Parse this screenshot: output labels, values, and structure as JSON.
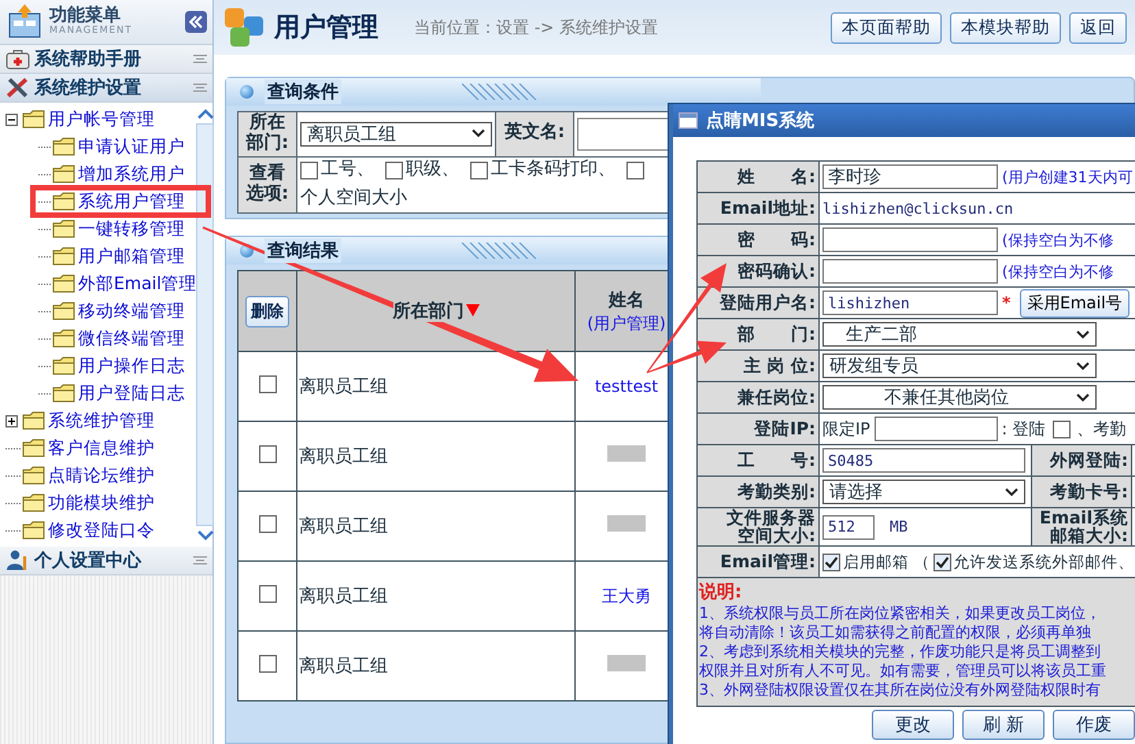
{
  "sidebar": {
    "title": "功能菜单",
    "subtitle": "MANAGEMENT",
    "sections": [
      {
        "label": "系统帮助手册",
        "kind": "help",
        "expanded": false
      },
      {
        "label": "系统维护设置",
        "kind": "tools",
        "expanded": true,
        "tree": [
          {
            "label": "用户帐号管理",
            "expanded": true,
            "highlighted": false,
            "children": [
              {
                "label": "申请认证用户",
                "highlighted": false
              },
              {
                "label": "增加系统用户",
                "highlighted": false
              },
              {
                "label": "系统用户管理",
                "highlighted": true
              },
              {
                "label": "一键转移管理",
                "highlighted": false
              },
              {
                "label": "用户邮箱管理",
                "highlighted": false
              },
              {
                "label": "外部Email管理",
                "highlighted": false
              },
              {
                "label": "移动终端管理",
                "highlighted": false
              },
              {
                "label": "微信终端管理",
                "highlighted": false
              },
              {
                "label": "用户操作日志",
                "highlighted": false
              },
              {
                "label": "用户登陆日志",
                "highlighted": false
              }
            ]
          },
          {
            "label": "系统维护管理",
            "expanded": false,
            "highlighted": false
          },
          {
            "label": "客户信息维护",
            "highlighted": false
          },
          {
            "label": "点睛论坛维护",
            "highlighted": false
          },
          {
            "label": "功能模块维护",
            "highlighted": false
          },
          {
            "label": "修改登陆口令",
            "highlighted": false
          }
        ]
      },
      {
        "label": "个人设置中心",
        "kind": "person",
        "expanded": false
      }
    ]
  },
  "header": {
    "title": "用户管理",
    "breadcrumb": "当前位置：设置 -> 系统维护设置",
    "buttons": [
      "本页面帮助",
      "本模块帮助",
      "返回"
    ]
  },
  "query": {
    "title": "查询条件",
    "department_label": "所在部门:",
    "department": "离职员工组",
    "english_name_label": "英文名:",
    "options_label": "查看选项:",
    "options": [
      {
        "label": "工号、",
        "checked": false
      },
      {
        "label": "职级、",
        "checked": false
      },
      {
        "label": "工卡条码打印、",
        "checked": false
      },
      {
        "checked": false
      }
    ],
    "options_more": "个人空间大小"
  },
  "results": {
    "title": "查询结果",
    "delete_button": "删除",
    "dept_header": "所在部门",
    "name_header": "姓名",
    "name_subheader": "(用户管理)",
    "rows": [
      {
        "checked": false,
        "department": "离职员工组",
        "name": "testtest"
      },
      {
        "checked": false,
        "department": "离职员工组",
        "redacted": true
      },
      {
        "checked": false,
        "department": "离职员工组",
        "redacted": true
      },
      {
        "checked": false,
        "department": "离职员工组",
        "name": "王大勇"
      },
      {
        "checked": false,
        "department": "离职员工组",
        "redacted": true
      }
    ]
  },
  "popup": {
    "title": "点睛MIS系统",
    "fields": [
      {
        "kind": "input",
        "label": "姓　　名:",
        "value": "李时珍",
        "note": "(用户创建31天内可"
      },
      {
        "kind": "plain",
        "label": "Email地址:",
        "value": "lishizhen@clicksun.cn"
      },
      {
        "kind": "input",
        "label": "密　　码:",
        "note": "(保持空白为不修"
      },
      {
        "kind": "input",
        "label": "密码确认:",
        "note": "(保持空白为不修"
      },
      {
        "kind": "input",
        "label": "登陆用户名:",
        "value": "lishizhen",
        "required_mark": "*",
        "button": "采用Email号"
      },
      {
        "kind": "select",
        "label": "部　　门:",
        "value": "生产二部"
      },
      {
        "kind": "select",
        "label": "主 岗 位:",
        "value": "研发组专员"
      },
      {
        "kind": "select",
        "label": "兼任岗位:",
        "value": "不兼任其他岗位"
      },
      {
        "kind": "ip",
        "label": "登陆IP:",
        "prefix": "限定IP",
        "suffix": ": 登陆",
        "checked": false,
        "after": "、考勤"
      },
      {
        "kind": "pair",
        "label": "工　　号:",
        "control": {
          "kind": "input",
          "value": "S0485"
        },
        "label2": "外网登陆:"
      },
      {
        "kind": "pair",
        "label": "考勤类别:",
        "control": {
          "kind": "select",
          "value": "请选择"
        },
        "label2": "考勤卡号:"
      },
      {
        "kind": "pair",
        "label": "文件服务器空间大小:",
        "control": {
          "kind": "size",
          "value": "512",
          "unit": "MB"
        },
        "label2": "Email系统邮箱大小:"
      },
      {
        "kind": "checks",
        "label": "Email管理:",
        "checks": [
          {
            "label": "启用邮箱 （",
            "checked": true
          },
          {
            "label": "允许发送系统外部邮件、",
            "checked": true
          }
        ]
      }
    ],
    "notes_title": "说明:",
    "notes": [
      "1、系统权限与员工所在岗位紧密相关，如果更改员工岗位，",
      "将自动清除！该员工如需获得之前配置的权限，必须再单独",
      "2、考虑到系统相关模块的完整，作废功能只是将员工调整到",
      "权限并且对所有人不可见。如有需要，管理员可以将该员工重",
      "3、外网登陆权限设置仅在其所在岗位没有外网登陆权限时有"
    ],
    "buttons": [
      "更改",
      "刷 新",
      "作废"
    ]
  }
}
